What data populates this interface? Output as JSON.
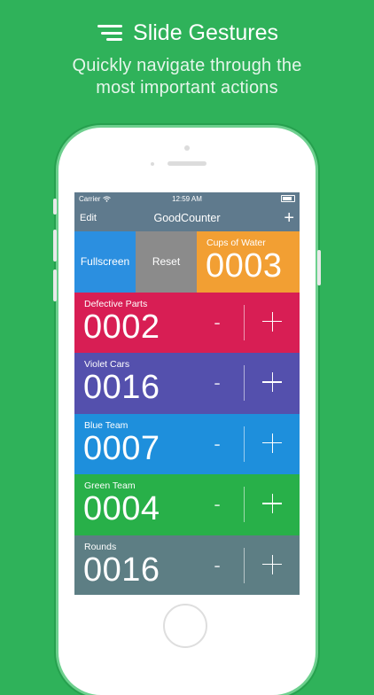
{
  "promo": {
    "title": "Slide Gestures",
    "subtitle_line1": "Quickly navigate through the",
    "subtitle_line2": "most important actions"
  },
  "status_bar": {
    "carrier": "Carrier",
    "time": "12:59 AM"
  },
  "nav": {
    "edit_label": "Edit",
    "title": "GoodCounter",
    "add_label": "+"
  },
  "actions": {
    "fullscreen_label": "Fullscreen",
    "reset_label": "Reset"
  },
  "counters": [
    {
      "name": "Cups of Water",
      "count": "0003",
      "color": "#f29f33"
    },
    {
      "name": "Defective Parts",
      "count": "0002",
      "color": "#d81e54"
    },
    {
      "name": "Violet Cars",
      "count": "0016",
      "color": "#5450ad"
    },
    {
      "name": "Blue Team",
      "count": "0007",
      "color": "#1e8fdc"
    },
    {
      "name": "Green Team",
      "count": "0004",
      "color": "#28b049"
    },
    {
      "name": "Rounds",
      "count": "0016",
      "color": "#5d7e84"
    }
  ],
  "controls": {
    "minus_label": "-"
  },
  "colors": {
    "background": "#2fb25a",
    "fullscreen_action": "#2b8fe0",
    "reset_action": "#8b8b8b",
    "navbar": "#5f7a8d"
  },
  "icons": [
    "menu-lines-icon",
    "wifi-icon",
    "battery-icon",
    "plus-icon"
  ]
}
